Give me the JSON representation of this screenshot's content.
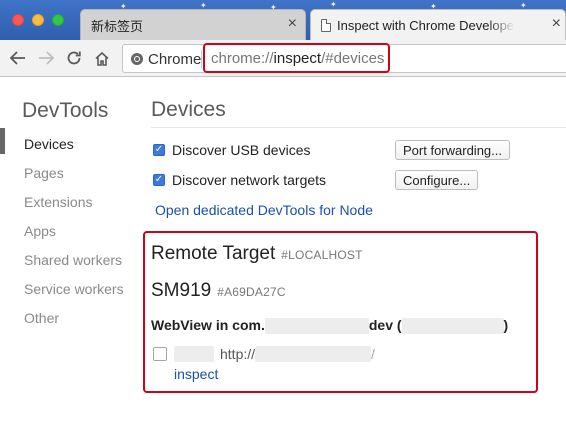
{
  "browser": {
    "tabs": [
      {
        "title": "新标签页",
        "active": false
      },
      {
        "title": "Inspect with Chrome Developer Tools",
        "active": true
      }
    ],
    "tab_close_glyph": "×",
    "omnibox": {
      "chip_label": "Chrome",
      "url_scheme": "chrome://",
      "url_host": "inspect",
      "url_rest": "/#devices"
    }
  },
  "sidebar": {
    "title": "DevTools",
    "items": [
      {
        "label": "Devices",
        "selected": true
      },
      {
        "label": "Pages"
      },
      {
        "label": "Extensions"
      },
      {
        "label": "Apps"
      },
      {
        "label": "Shared workers"
      },
      {
        "label": "Service workers"
      },
      {
        "label": "Other"
      }
    ]
  },
  "main": {
    "title": "Devices",
    "options": {
      "usb": {
        "label": "Discover USB devices",
        "checked": true,
        "button": "Port forwarding..."
      },
      "network": {
        "label": "Discover network targets",
        "checked": true,
        "button": "Configure..."
      }
    },
    "node_link": "Open dedicated DevTools for Node",
    "remote": {
      "title": "Remote Target",
      "host": "#LOCALHOST",
      "device_name": "SM919",
      "device_serial": "#A69DA27C",
      "webview_prefix": "WebView in com.",
      "webview_suffix": "dev (",
      "webview_close": ")",
      "page_url_prefix": "http://",
      "page_url_suffix": "/",
      "inspect_link": "inspect"
    }
  },
  "colors": {
    "tabstrip": "#3f74c8",
    "highlight": "#d0021b",
    "link": "#1a4fb4",
    "checkbox": "#3b7be0"
  }
}
